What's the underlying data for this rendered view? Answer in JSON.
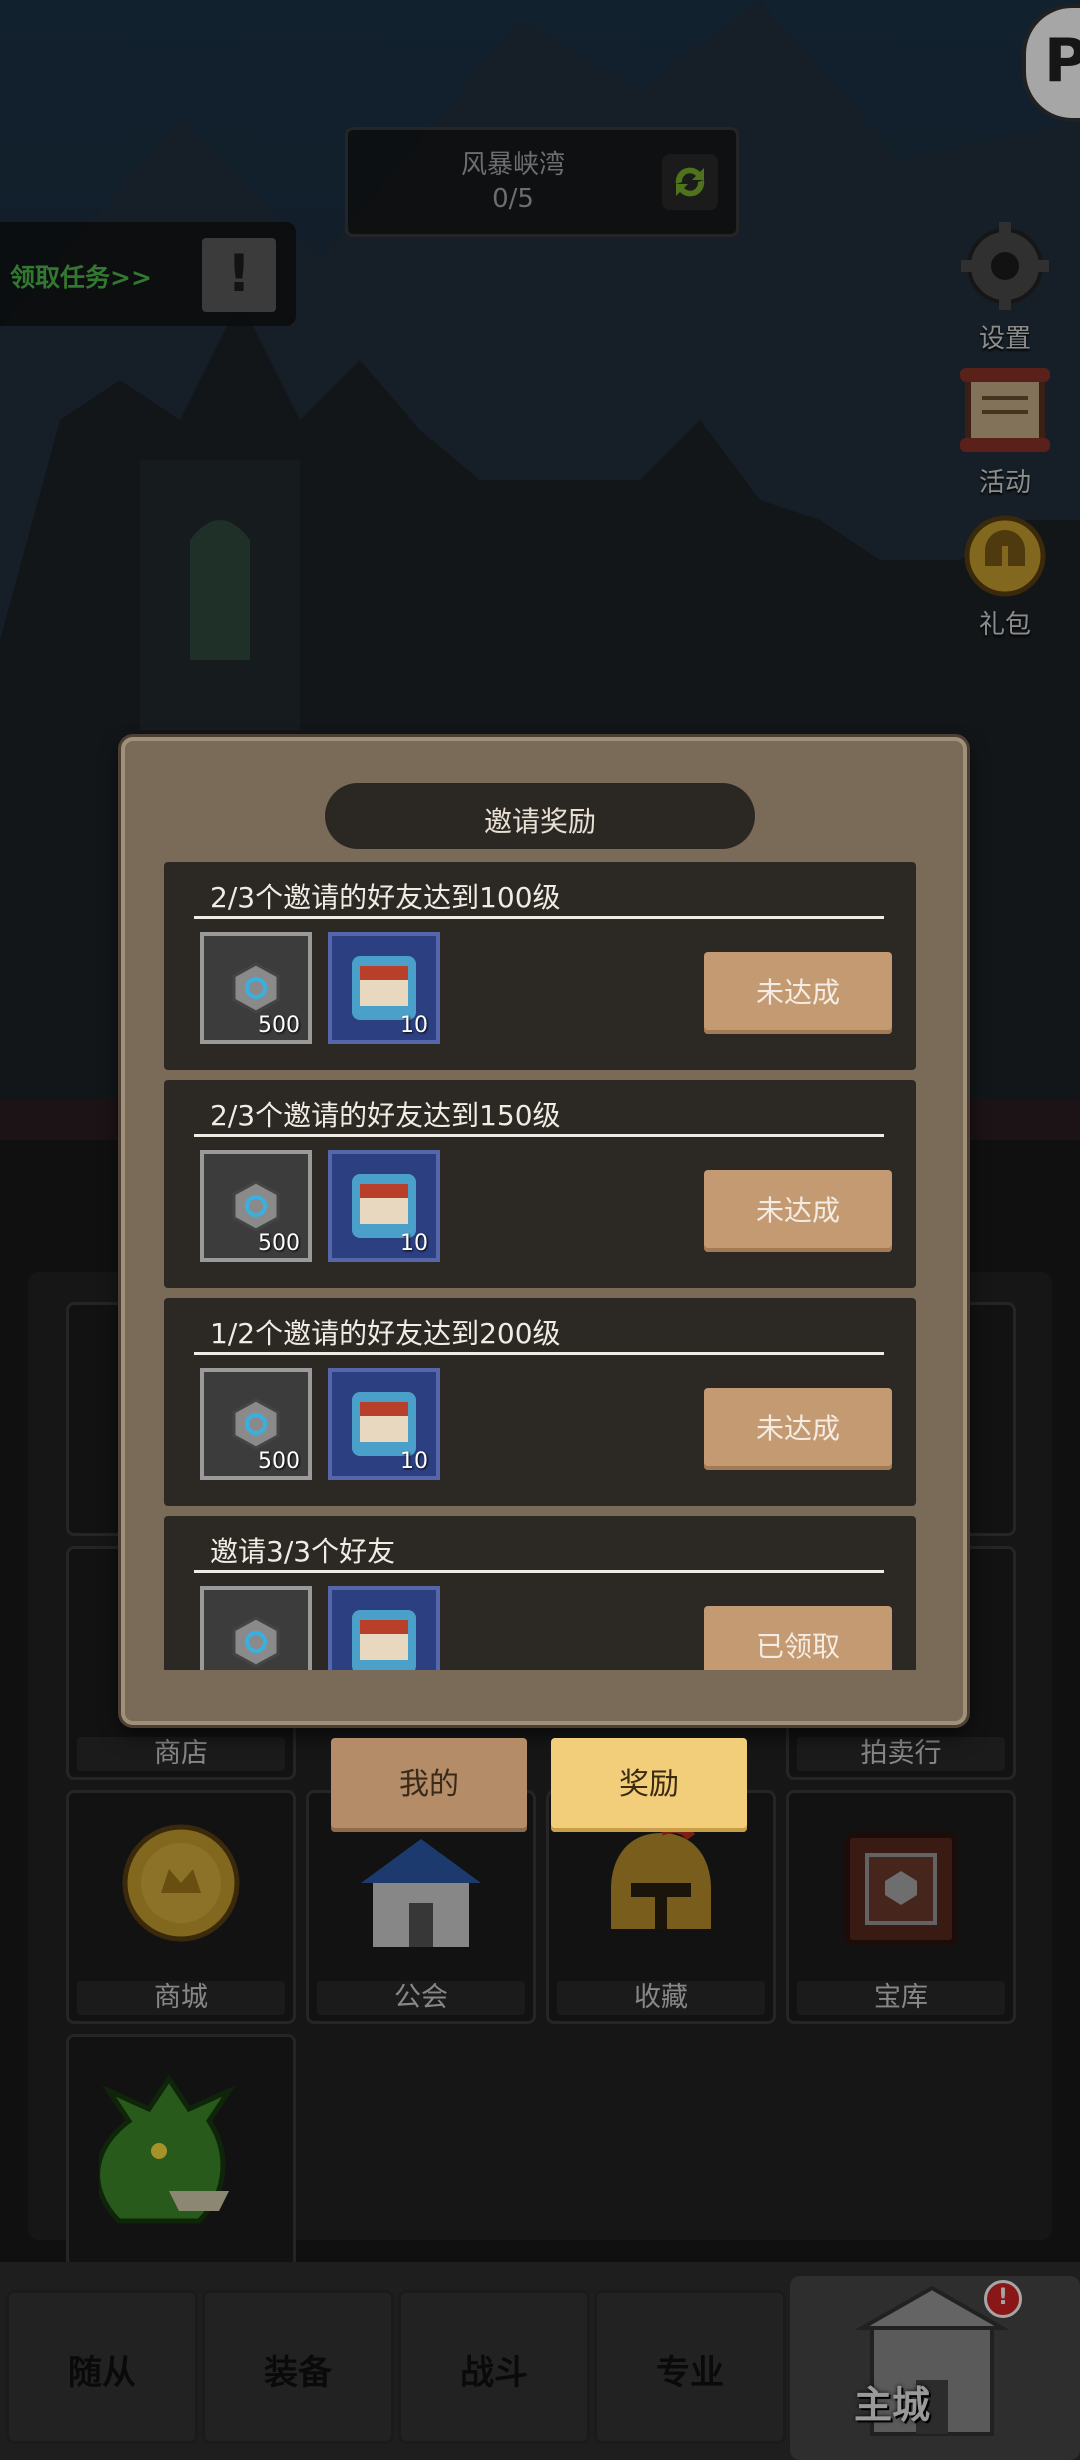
{
  "top": {
    "task_title": "风暴峡湾",
    "task_progress": "0/5",
    "quest_label": "领取任务>>",
    "quest_alert": "!"
  },
  "side_buttons": [
    {
      "label": "设置",
      "icon": "gear-icon"
    },
    {
      "label": "活动",
      "icon": "scroll-icon"
    },
    {
      "label": "礼包",
      "icon": "helmet-coin-icon"
    }
  ],
  "menu_grid": {
    "row2": [
      "商店",
      "",
      "",
      "拍卖行"
    ],
    "row3": [
      "商城",
      "公会",
      "收藏",
      "宝库"
    ]
  },
  "modal": {
    "title": "邀请奖励",
    "rows": [
      {
        "title": "2/3个邀请的好友达到100级",
        "gem_qty": "500",
        "food_qty": "10",
        "status": "未达成"
      },
      {
        "title": "2/3个邀请的好友达到150级",
        "gem_qty": "500",
        "food_qty": "10",
        "status": "未达成"
      },
      {
        "title": "1/2个邀请的好友达到200级",
        "gem_qty": "500",
        "food_qty": "10",
        "status": "未达成"
      },
      {
        "title": "邀请3/3个好友",
        "gem_qty": "",
        "food_qty": "",
        "status": "已领取"
      }
    ],
    "tab_mine": "我的",
    "tab_reward": "奖励"
  },
  "bottom_nav": {
    "tabs": [
      "随从",
      "装备",
      "战斗",
      "专业"
    ],
    "home": "主城",
    "home_badge": "!"
  },
  "colors": {
    "accent_gold": "#f2ce7a",
    "status_button": "#c49a72",
    "quest_green": "#4fb84a"
  }
}
